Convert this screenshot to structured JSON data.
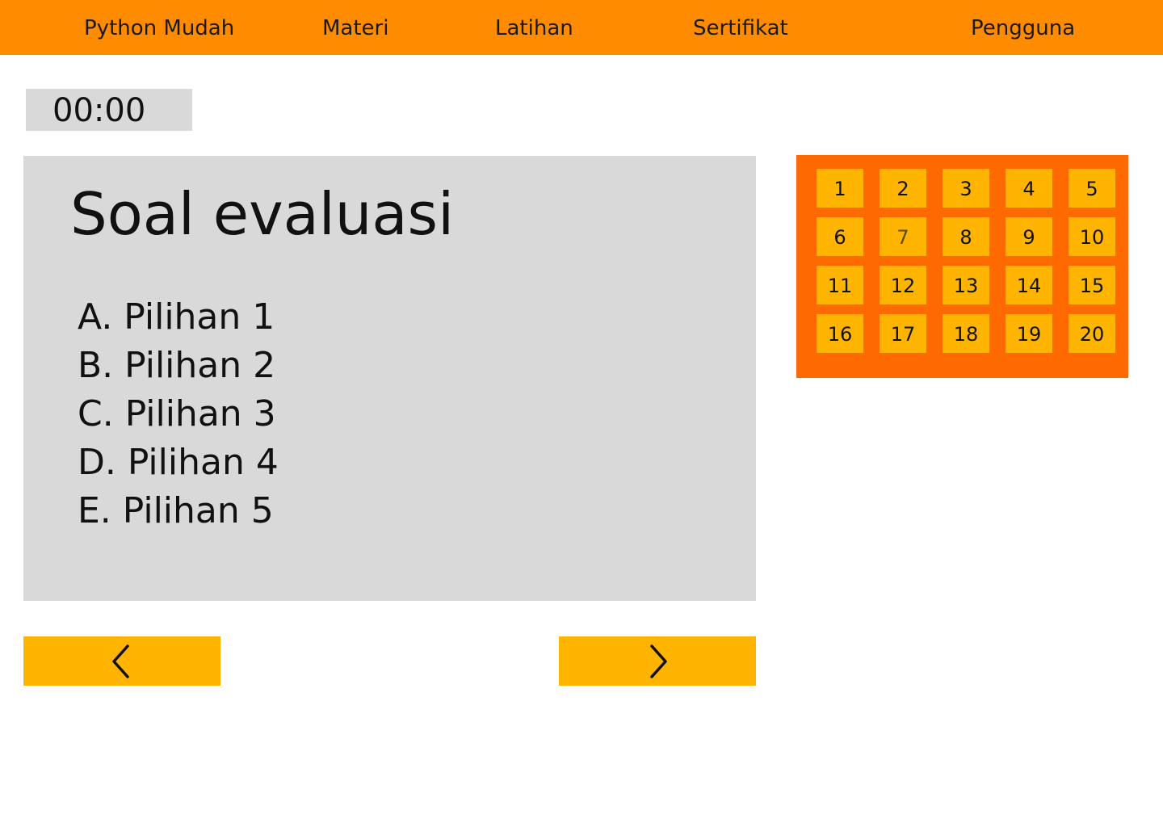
{
  "nav": {
    "brand": "Python Mudah",
    "items": [
      "Materi",
      "Latihan",
      "Sertifikat"
    ],
    "user": "Pengguna"
  },
  "timer": {
    "value": "00:00"
  },
  "question": {
    "title": "Soal evaluasi",
    "options": [
      "A. Pilihan 1",
      "B. Pilihan 2",
      "C. Pilihan 3",
      "D. Pilihan 4",
      "E. Pilihan 5"
    ]
  },
  "navigation": {
    "prev_icon": "chevron-left-icon",
    "next_icon": "chevron-right-icon"
  },
  "question_numbers": {
    "numbers": [
      "1",
      "2",
      "3",
      "4",
      "5",
      "6",
      "7",
      "8",
      "9",
      "10",
      "11",
      "12",
      "13",
      "14",
      "15",
      "16",
      "17",
      "18",
      "19",
      "20"
    ],
    "current": "7"
  },
  "colors": {
    "topbar": "#ff8c00",
    "panel": "#d9d9d9",
    "number_panel": "#ff6a00",
    "button": "#ffb400"
  }
}
